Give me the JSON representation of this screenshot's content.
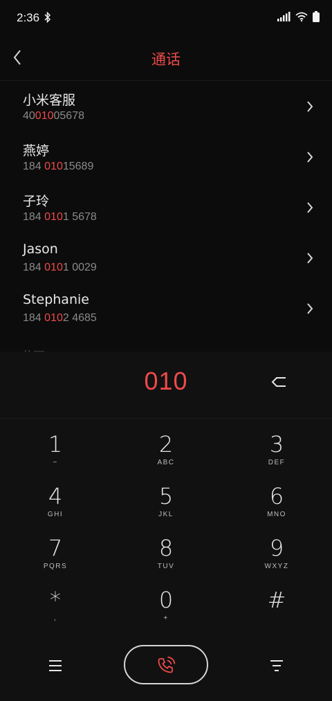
{
  "status_bar": {
    "time": "2:36",
    "icons": [
      "bluetooth-icon",
      "signal-icon",
      "wifi-icon",
      "battery-icon"
    ]
  },
  "nav": {
    "title": "通话",
    "back_icon": "chevron-left-icon"
  },
  "contacts": [
    {
      "name": "小米客服",
      "number_prefix": "40",
      "number_match": "010",
      "number_suffix": "05678"
    },
    {
      "name": "燕婷",
      "number_prefix": "184 ",
      "number_match": "010",
      "number_suffix": "15689"
    },
    {
      "name": "子玲",
      "number_prefix": "184 ",
      "number_match": "010",
      "number_suffix": "1 5678"
    },
    {
      "name": "Jason",
      "number_prefix": "184 ",
      "number_match": "010",
      "number_suffix": "1 0029"
    },
    {
      "name": "Stephanie",
      "number_prefix": "184 ",
      "number_match": "010",
      "number_suffix": "2 4685"
    }
  ],
  "contact_cutoff": "黄丽",
  "dialer": {
    "input": "010",
    "keys": [
      {
        "digit": "1",
        "letters": "~"
      },
      {
        "digit": "2",
        "letters": "ABC"
      },
      {
        "digit": "3",
        "letters": "DEF"
      },
      {
        "digit": "4",
        "letters": "GHI"
      },
      {
        "digit": "5",
        "letters": "JKL"
      },
      {
        "digit": "6",
        "letters": "MNO"
      },
      {
        "digit": "7",
        "letters": "PQRS"
      },
      {
        "digit": "8",
        "letters": "TUV"
      },
      {
        "digit": "9",
        "letters": "WXYZ"
      },
      {
        "digit": "*",
        "letters": ","
      },
      {
        "digit": "0",
        "letters": "+"
      },
      {
        "digit": "#",
        "letters": ""
      }
    ]
  },
  "colors": {
    "accent": "#ef4a4a",
    "background": "#0c0c0c",
    "panel": "#111111",
    "secondary_text": "#8a8a8a"
  }
}
